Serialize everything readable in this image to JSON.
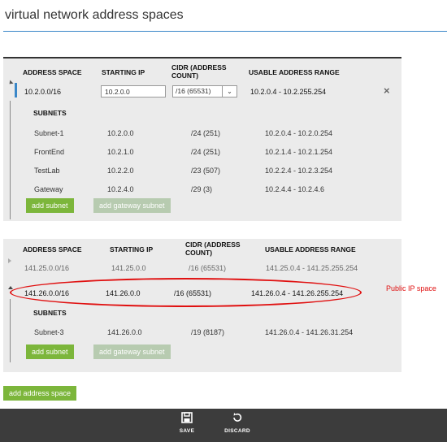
{
  "page": {
    "title": "virtual network address spaces"
  },
  "columns": {
    "address_space": "ADDRESS SPACE",
    "starting_ip": "STARTING IP",
    "cidr": "CIDR (ADDRESS COUNT)",
    "usable_range": "USABLE ADDRESS RANGE",
    "subnets": "SUBNETS"
  },
  "space1": {
    "address": "10.2.0.0/16",
    "starting_ip": "10.2.0.0",
    "cidr": "/16 (65531)",
    "range": "10.2.0.4 - 10.2.255.254",
    "subnets": [
      {
        "name": "Subnet-1",
        "ip": "10.2.0.0",
        "cidr": "/24 (251)",
        "range": "10.2.0.4 - 10.2.0.254"
      },
      {
        "name": "FrontEnd",
        "ip": "10.2.1.0",
        "cidr": "/24 (251)",
        "range": "10.2.1.4 - 10.2.1.254"
      },
      {
        "name": "TestLab",
        "ip": "10.2.2.0",
        "cidr": "/23 (507)",
        "range": "10.2.2.4 - 10.2.3.254"
      },
      {
        "name": "Gateway",
        "ip": "10.2.4.0",
        "cidr": "/29 (3)",
        "range": "10.2.4.4 - 10.2.4.6"
      }
    ]
  },
  "space2": {
    "collapsed": {
      "address": "141.25.0.0/16",
      "starting_ip": "141.25.0.0",
      "cidr": "/16 (65531)",
      "range": "141.25.0.4 - 141.25.255.254"
    },
    "highlighted": {
      "address": "141.26.0.0/16",
      "starting_ip": "141.26.0.0",
      "cidr": "/16 (65531)",
      "range": "141.26.0.4 - 141.26.255.254"
    },
    "subnets": [
      {
        "name": "Subnet-3",
        "ip": "141.26.0.0",
        "cidr": "/19 (8187)",
        "range": "141.26.0.4 - 141.26.31.254"
      }
    ]
  },
  "buttons": {
    "add_subnet": "add subnet",
    "add_gateway_subnet": "add gateway subnet",
    "add_address_space": "add address space"
  },
  "annotation": "Public IP space",
  "bottom_bar": {
    "save": "SAVE",
    "discard": "DISCARD"
  },
  "icons": {
    "save": "save-icon",
    "discard": "discard-icon",
    "close": "close-icon",
    "expand": "chevron-down-icon"
  },
  "colors": {
    "accent": "#3a87c8",
    "button_green": "#7cb63b",
    "annotation_red": "#e01010",
    "bottom_bar": "#3c3c3c"
  }
}
